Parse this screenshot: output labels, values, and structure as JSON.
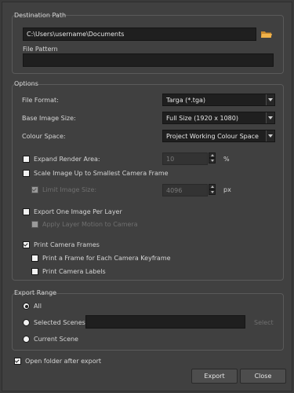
{
  "destination": {
    "group_title": "Destination Path",
    "path_value": "C:\\Users\\username\\Documents",
    "file_pattern_label": "File Pattern",
    "file_pattern_value": ""
  },
  "options": {
    "group_title": "Options",
    "file_format_label": "File Format:",
    "file_format_value": "Targa (*.tga)",
    "image_size_label": "Base Image Size:",
    "image_size_value": "Full Size (1920 x 1080)",
    "colour_space_label": "Colour Space:",
    "colour_space_value": "Project Working Colour Space",
    "expand_render_area_label": "Expand Render Area:",
    "expand_render_area_value": "10",
    "expand_render_area_unit": "%",
    "expand_render_area_checked": false,
    "scale_image_label": "Scale Image Up to Smallest Camera Frame",
    "scale_image_checked": false,
    "limit_image_size_label": "Limit Image Size:",
    "limit_image_size_value": "4096",
    "limit_image_size_unit": "px",
    "limit_image_size_checked": true,
    "export_one_image_label": "Export One Image Per Layer",
    "export_one_image_checked": false,
    "apply_layer_motion_label": "Apply Layer Motion to Camera",
    "apply_layer_motion_checked": false,
    "print_camera_frames_label": "Print Camera Frames",
    "print_camera_frames_checked": true,
    "print_frame_each_keyframe_label": "Print a Frame for Each Camera Keyframe",
    "print_frame_each_keyframe_checked": false,
    "print_camera_labels_label": "Print Camera Labels",
    "print_camera_labels_checked": false
  },
  "export_range": {
    "group_title": "Export Range",
    "all_label": "All",
    "selected_scenes_label": "Selected Scenes",
    "selected_scenes_value": "",
    "select_button_label": "Select",
    "current_scene_label": "Current Scene",
    "selected_option": "all"
  },
  "footer": {
    "open_folder_label": "Open folder after export",
    "open_folder_checked": true,
    "export_button_label": "Export",
    "close_button_label": "Close"
  },
  "icons": {
    "browse": "folder-icon",
    "dropdown": "chevron-down-icon"
  },
  "colors": {
    "background": "#404040",
    "field": "#1f1f1f",
    "folder": "#e8a640"
  }
}
